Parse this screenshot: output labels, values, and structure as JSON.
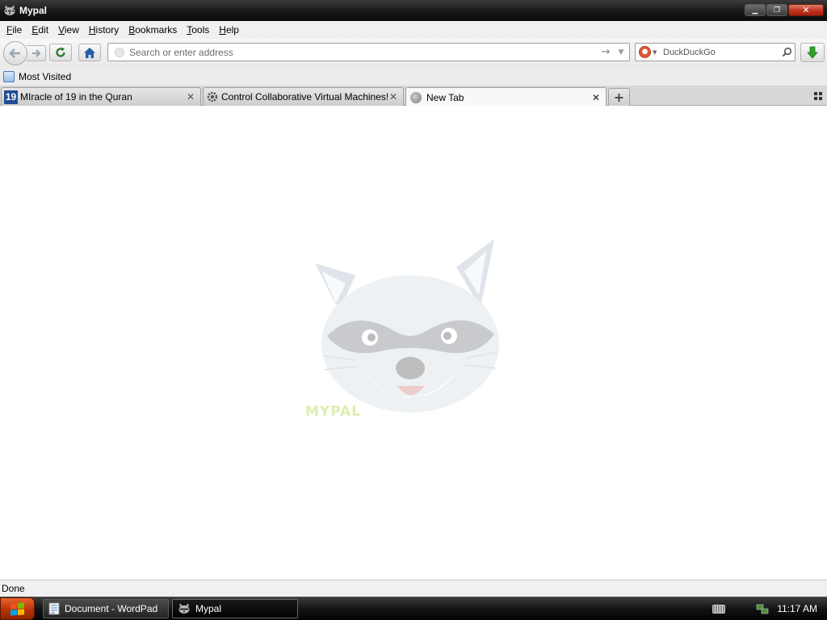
{
  "window": {
    "title": "Mypal",
    "controls": {
      "minimize": "▁",
      "maximize": "❐",
      "close": "✕"
    }
  },
  "menubar": {
    "items": [
      {
        "label": "File",
        "u": "F",
        "rest": "ile"
      },
      {
        "label": "Edit",
        "u": "E",
        "rest": "dit"
      },
      {
        "label": "View",
        "u": "V",
        "rest": "iew"
      },
      {
        "label": "History",
        "u": "H",
        "rest": "istory"
      },
      {
        "label": "Bookmarks",
        "u": "B",
        "rest": "ookmarks"
      },
      {
        "label": "Tools",
        "u": "T",
        "rest": "ools"
      },
      {
        "label": "Help",
        "u": "H",
        "rest": "elp"
      }
    ]
  },
  "navbar": {
    "address_placeholder": "Search or enter address",
    "address_value": "",
    "search_engine": "DuckDuckGo",
    "search_placeholder": "DuckDuckGo",
    "go_glyph": "→",
    "dropdown_glyph": "▼"
  },
  "bookmarks": {
    "items": [
      {
        "label": "Most Visited",
        "icon": "most-visited-icon"
      }
    ]
  },
  "tabs": {
    "items": [
      {
        "label": "MIracle of 19 in the Quran",
        "icon_text": "19",
        "active": false
      },
      {
        "label": "Control Collaborative Virtual Machines!",
        "icon": "gear-icon",
        "active": false
      },
      {
        "label": "New Tab",
        "icon": "globe-icon",
        "active": true
      }
    ],
    "close_glyph": "✕",
    "new_tab_glyph": "+"
  },
  "content": {
    "watermark_text": "MYPAL"
  },
  "statusbar": {
    "text": "Done"
  },
  "taskbar": {
    "tasks": [
      {
        "label": "Document - WordPad",
        "active": false
      },
      {
        "label": "Mypal",
        "active": true
      }
    ],
    "clock": "11:17 AM"
  },
  "colors": {
    "titlebar": "#161616",
    "close_button": "#c0331d",
    "start_button": "#b63407",
    "download_arrow": "#2aa12a",
    "tab_19_icon": "#1f4d96"
  }
}
